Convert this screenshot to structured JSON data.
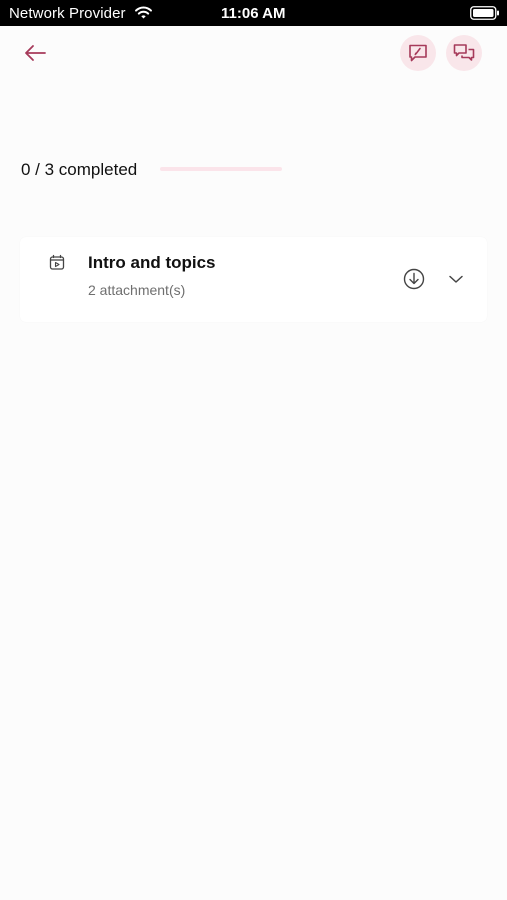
{
  "status_bar": {
    "carrier": "Network Provider",
    "time": "11:06 AM",
    "icons": [
      "wifi-icon",
      "battery-icon"
    ]
  },
  "header": {
    "back_icon": "arrow-left-icon",
    "actions": [
      {
        "icon": "feedback-icon"
      },
      {
        "icon": "chat-bubbles-icon"
      }
    ],
    "accent_color": "#a63a5a",
    "action_bg_color": "#f9e6ea"
  },
  "progress": {
    "label": "0 / 3 completed",
    "completed": 0,
    "total": 3
  },
  "modules": [
    {
      "icon": "video-calendar-icon",
      "title": "Intro and topics",
      "subtitle": "2 attachment(s)",
      "download_icon": "download-circle-icon",
      "expand_icon": "chevron-down-icon"
    }
  ]
}
